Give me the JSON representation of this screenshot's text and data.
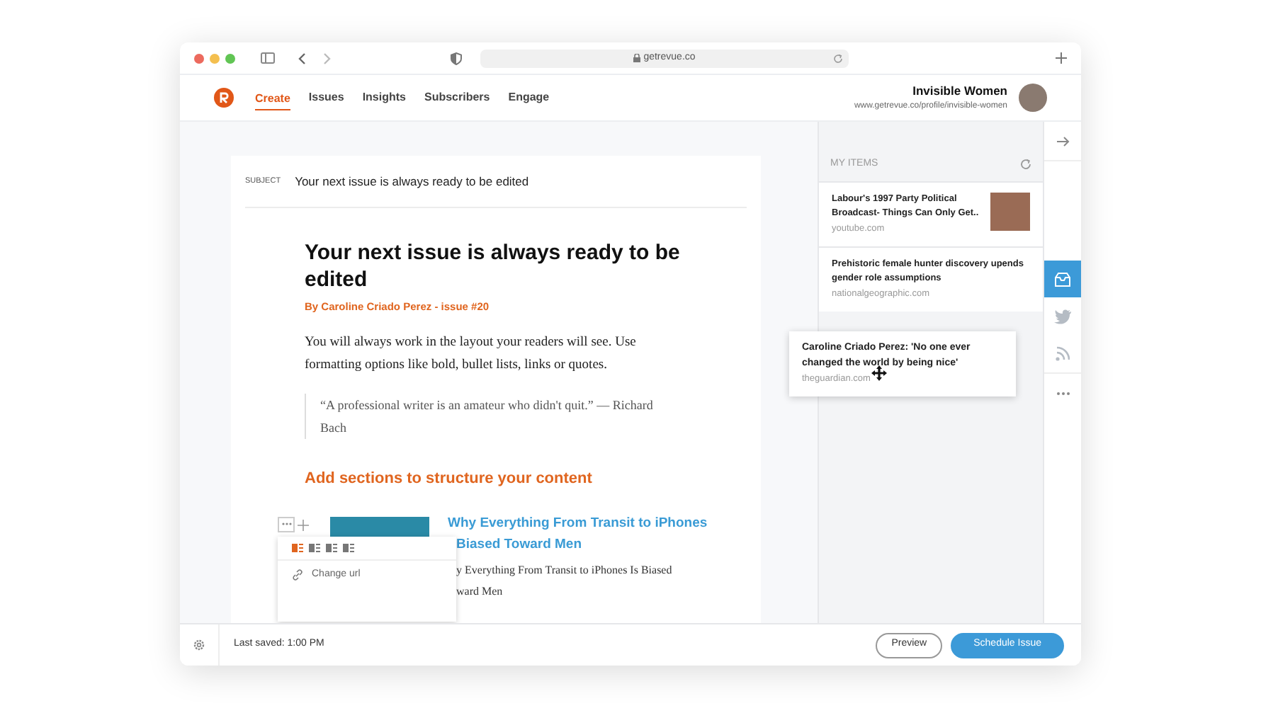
{
  "browser": {
    "url": "getrevue.co"
  },
  "nav": {
    "tabs": [
      {
        "label": "Create",
        "selected": true
      },
      {
        "label": "Issues",
        "selected": false
      },
      {
        "label": "Insights",
        "selected": false
      },
      {
        "label": "Subscribers",
        "selected": false
      },
      {
        "label": "Engage",
        "selected": false
      }
    ],
    "profile": {
      "name": "Invisible Women",
      "url": "www.getrevue.co/profile/invisible-women"
    }
  },
  "editor": {
    "subject_label": "SUBJECT",
    "subject": "Your next issue is always ready to be edited",
    "title": "Your next issue is always ready to be edited",
    "byline": "By Caroline Criado Perez - issue #20",
    "body": "You will always work in the layout your readers will see. Use formatting options like bold, bullet lists, links or quotes.",
    "quote": "“A professional writer is an amateur who didn't quit.” — Richard Bach",
    "section_heading": "Add sections to structure your content",
    "article": {
      "title_lines": [
        "Why Everything From Transit to iPhones",
        "Biased Toward Men"
      ],
      "description_lines": [
        "y Everything From Transit to iPhones Is Biased",
        "ward Men"
      ]
    },
    "block_menu": {
      "layouts": [
        {
          "selected": true
        },
        {
          "selected": false
        },
        {
          "selected": false
        },
        {
          "selected": false
        }
      ],
      "items": [
        {
          "label": "Change url"
        }
      ]
    }
  },
  "side_panel": {
    "heading": "MY ITEMS",
    "items": [
      {
        "title": "Labour's 1997 Party Political Broadcast- Things Can Only Get..",
        "source": "youtube.com",
        "thumbnail": true
      },
      {
        "title": "Prehistoric female hunter discovery upends gender role assumptions",
        "source": "nationalgeographic.com",
        "thumbnail": false
      }
    ],
    "dragged_item": {
      "title": "Caroline Criado Perez: 'No one ever changed the world by being nice'",
      "source": "theguardian.com"
    }
  },
  "rail": [
    {
      "kind": "collapse",
      "selected": false
    },
    {
      "kind": "inbox",
      "selected": true
    },
    {
      "kind": "twitter",
      "selected": false
    },
    {
      "kind": "rss",
      "selected": false
    },
    {
      "kind": "more",
      "selected": false
    }
  ],
  "footer": {
    "status": "Last saved: 1:00 PM",
    "buttons": [
      {
        "label": "Preview",
        "kind": "secondary"
      },
      {
        "label": "Schedule Issue",
        "kind": "primary"
      }
    ]
  }
}
